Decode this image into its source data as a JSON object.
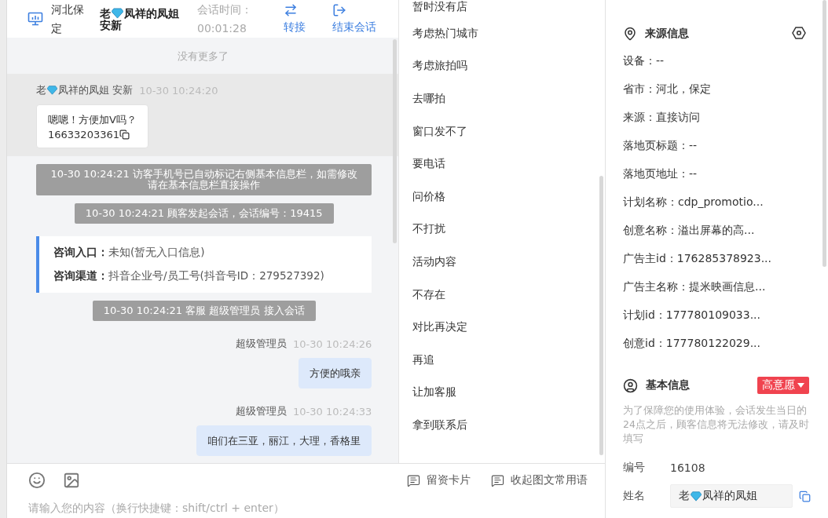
{
  "header": {
    "location": "河北保定",
    "visitor_prefix": "老",
    "visitor_rest": "凤祥的凤姐安新",
    "timer_label": "会话时间：",
    "timer": "00:01:28",
    "actions": [
      {
        "kind": "transfer",
        "label": "转接"
      },
      {
        "kind": "end",
        "label": "结束会话"
      }
    ]
  },
  "chat": {
    "no_more": "没有更多了",
    "messages": [
      {
        "kind": "visitor",
        "name_prefix": "老",
        "name_rest": "凤祥的凤姐 安新",
        "time": "10-30 10:24:20",
        "text": "嗯嗯！方便加V吗？",
        "phone": "16633203361",
        "highlighted": true
      },
      {
        "kind": "system",
        "text": "10-30 10:24:21 访客手机号已自动标记右侧基本信息栏，如需修改请在基本信息栏直接操作"
      },
      {
        "kind": "system",
        "text": "10-30 10:24:21 顾客发起会话，会话编号：19415"
      },
      {
        "kind": "info",
        "rows": [
          {
            "label": "咨询入口：",
            "value": "未知(暂无入口信息)"
          },
          {
            "label": "咨询渠道：",
            "value": "抖音企业号/员工号(抖音号ID：279527392)"
          }
        ]
      },
      {
        "kind": "system",
        "text": "10-30 10:24:21 客服 超级管理员 接入会话"
      },
      {
        "kind": "agent",
        "name": "超级管理员",
        "time": "10-30 10:24:26",
        "text": "方便的哦亲"
      },
      {
        "kind": "agent",
        "name": "超级管理员",
        "time": "10-30 10:24:33",
        "text": "咱们在三亚，丽江，大理，香格里"
      }
    ]
  },
  "quick_phrases": [
    "暂时没有店",
    "考虑热门城市",
    "考虑旅拍吗",
    "去哪拍",
    "窗口发不了",
    "要电话",
    "问价格",
    "不打扰",
    "活动内容",
    "不存在",
    "对比再决定",
    "再追",
    "让加客服",
    "拿到联系后"
  ],
  "toolbar_buttons": [
    "留资卡片",
    "收起图文常用语"
  ],
  "input": {
    "placeholder": "请输入您的内容（换行快捷键：shift/ctrl + enter）"
  },
  "source_info": {
    "title": "来源信息",
    "rows": [
      "设备：--",
      "省市：河北，保定",
      "来源：直接访问",
      "落地页标题：--",
      "落地页地址：--",
      "计划名称：cdp_promotio...",
      "创意名称：溢出屏幕的高...",
      "广告主id：176285378923...",
      "广告主名称：提米映画信息...",
      "计划id：177780109033...",
      "创意id：177780122029..."
    ]
  },
  "basic_info": {
    "title": "基本信息",
    "intent_tag": "高意愿",
    "notice": "为了保障您的使用体验，会话发生当日的24点之后，顾客信息将无法修改，请及时填写",
    "fields": [
      {
        "kind": "text",
        "label": "编号",
        "value": "16108"
      },
      {
        "kind": "name",
        "label": "姓名",
        "value_prefix": "老",
        "value_rest": "凤祥的凤姐"
      }
    ]
  }
}
